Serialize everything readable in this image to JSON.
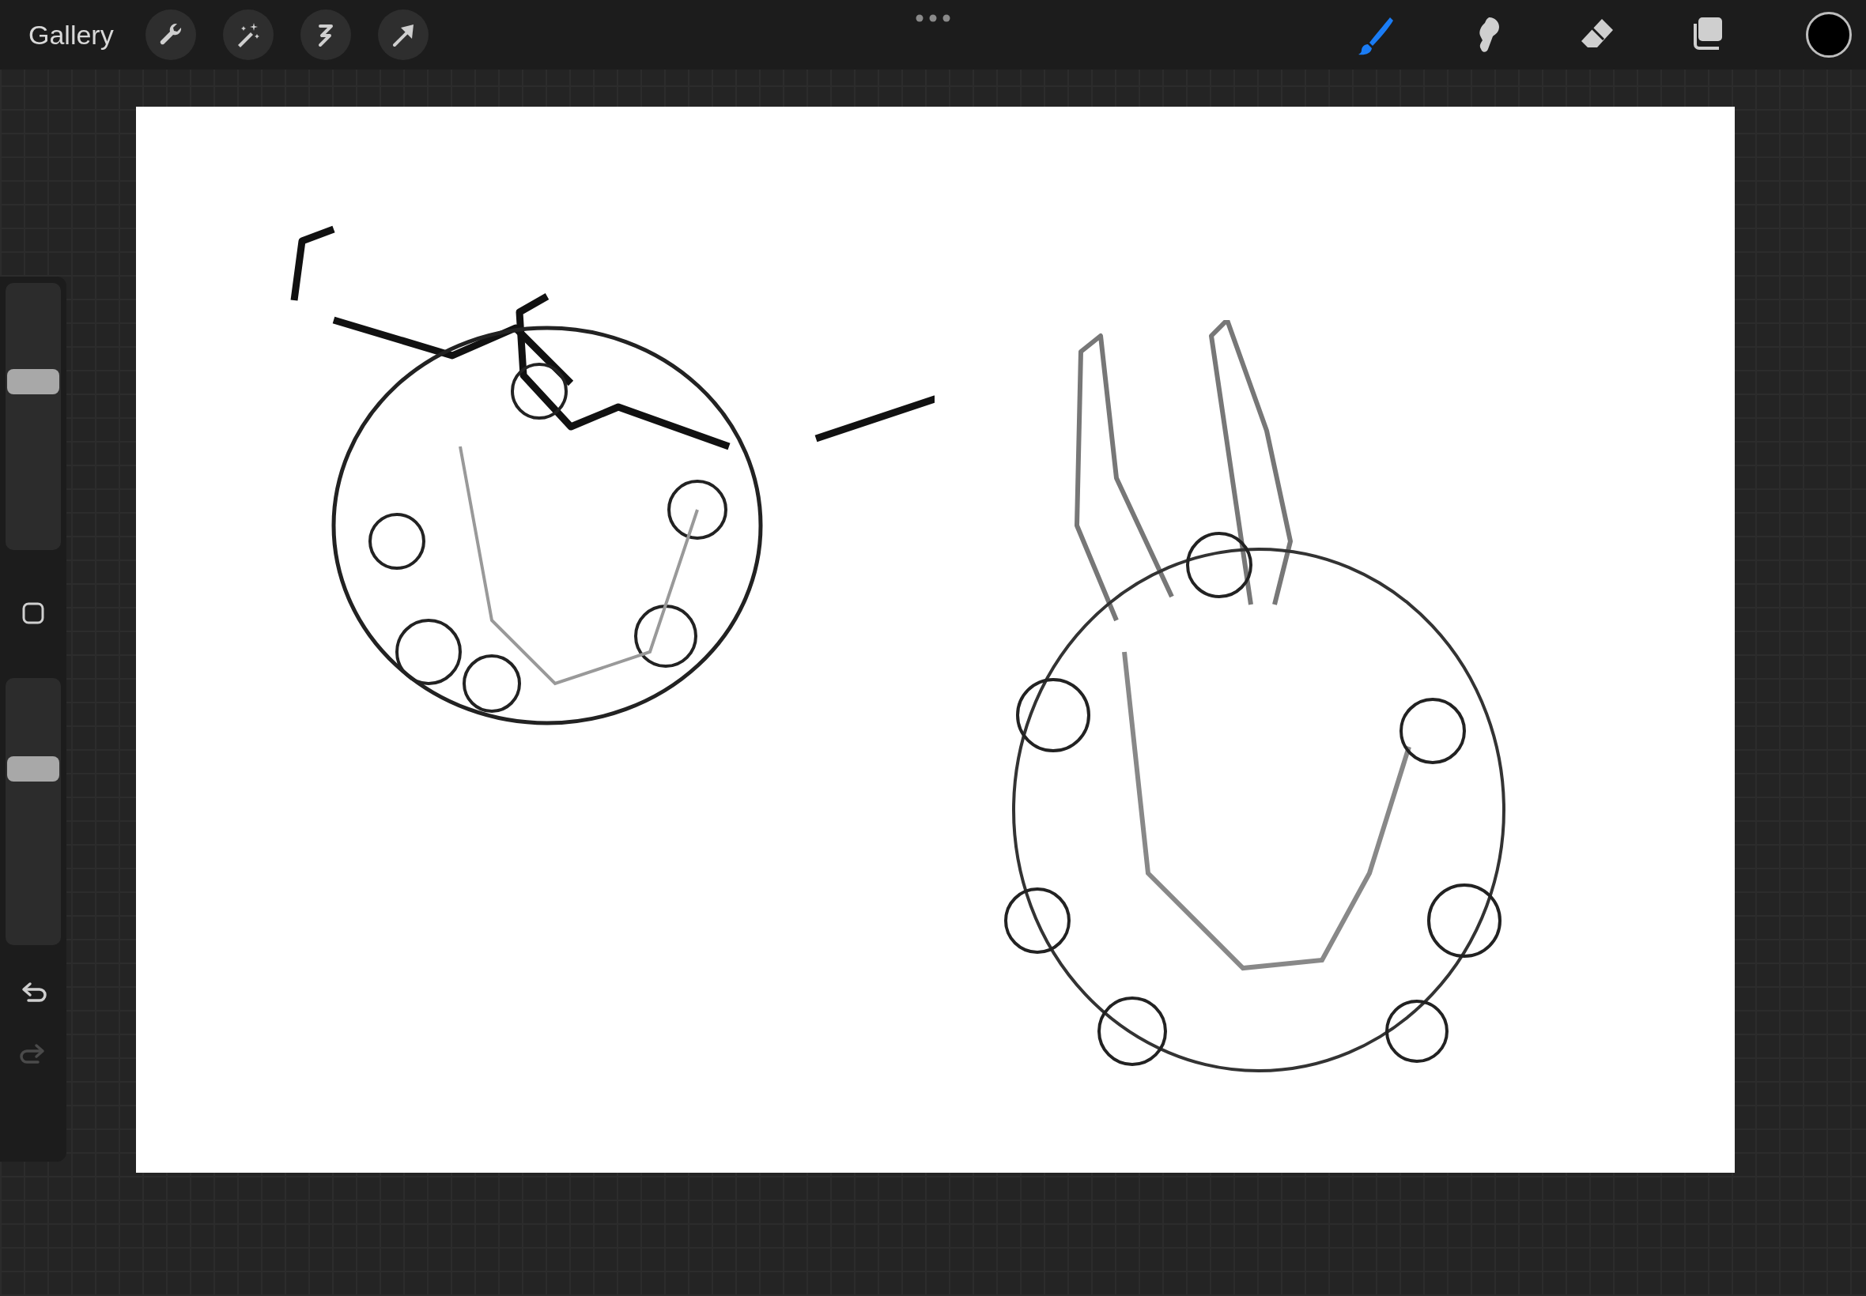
{
  "top_bar": {
    "gallery": "Gallery",
    "actions": [
      {
        "kind": "wrench"
      },
      {
        "kind": "wand"
      },
      {
        "kind": "selection"
      },
      {
        "kind": "transform"
      }
    ],
    "tools": [
      {
        "kind": "brush",
        "selected": true
      },
      {
        "kind": "smudge",
        "selected": false
      },
      {
        "kind": "eraser",
        "selected": false
      },
      {
        "kind": "layers",
        "selected": false
      }
    ],
    "current_color": {
      "color": "#000000"
    }
  },
  "sidebar": {
    "sliders": [
      {
        "level": 0.63
      },
      {
        "level": 0.66
      }
    ],
    "undo": {
      "disabled": false
    },
    "redo": {
      "disabled": true
    }
  }
}
